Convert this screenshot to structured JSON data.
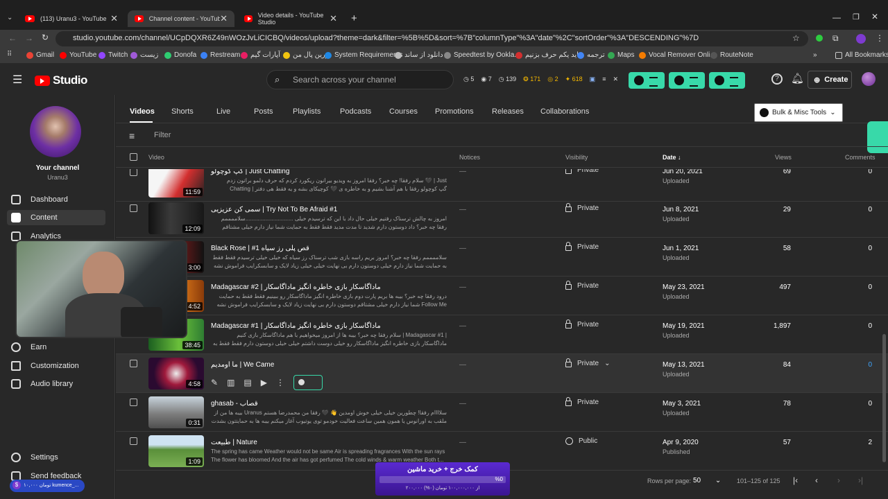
{
  "browser": {
    "tabs": [
      {
        "title": "(113) Uranu3 - YouTube",
        "active": false
      },
      {
        "title": "Channel content - YouTube Stu",
        "active": true
      },
      {
        "title": "Video details - YouTube Studio",
        "active": false
      }
    ],
    "url": "studio.youtube.com/channel/UCpDQXR6Z49nWOzJvLiCICBQ/videos/upload?theme=dark&filter=%5B%5D&sort=%7B\"columnType\"%3A\"date\"%2C\"sortOrder\"%3A\"DESCENDING\"%7D",
    "bookmarks": [
      "Gmail",
      "YouTube",
      "Twitch",
      "زیست",
      "Donofa",
      "Restream",
      "آپارات گیم",
      "زرین پال من",
      "System Requirements",
      "دانلود از ساند",
      "Speedtest by Ookla...",
      "بیاید یکم حرف بزنیم",
      "ترجمه",
      "Maps",
      "Vocal Remover Onli...",
      "RouteNote"
    ],
    "all_bookmarks": "All Bookmarks"
  },
  "studio": {
    "logo": "Studio",
    "search_placeholder": "Search across your channel",
    "stats": [
      "5",
      "7",
      "139",
      "171",
      "2",
      "618"
    ],
    "create": "Create"
  },
  "sidebar": {
    "your_channel": "Your channel",
    "channel_name": "Uranu3",
    "items": [
      {
        "label": "Dashboard",
        "icon": "dashboard-icon",
        "active": false
      },
      {
        "label": "Content",
        "icon": "content-icon",
        "active": true
      },
      {
        "label": "Analytics",
        "icon": "analytics-icon",
        "active": false
      },
      {
        "label": "Earn",
        "icon": "dollar-icon",
        "active": false
      },
      {
        "label": "Customization",
        "icon": "customization-icon",
        "active": false
      },
      {
        "label": "Audio library",
        "icon": "audio-library-icon",
        "active": false
      }
    ],
    "settings": "Settings",
    "send_feedback": "Send feedback"
  },
  "content_tabs": [
    "Videos",
    "Shorts",
    "Live",
    "Posts",
    "Playlists",
    "Podcasts",
    "Courses",
    "Promotions",
    "Releases",
    "Collaborations"
  ],
  "bulk_tools": "Bulk & Misc Tools",
  "filter_placeholder": "Filter",
  "columns": {
    "video": "Video",
    "notices": "Notices",
    "visibility": "Visibility",
    "date": "Date",
    "views": "Views",
    "comments": "Comments"
  },
  "videos": [
    {
      "title": "گپ کوچولو | Just Chatting",
      "desc": "سلام رفقا! چه خبر؟ رفقا امروز به ویدیو بیرانون ریکورد کردم که حرف دلمو براتون زدم 🖤 | Just Chatting | گپ کوچولو\nرفقا با هم آشنا بشیم و به خاطره ی 🖤 کوچیکای بشه و یه فقط هی دفتر خاطرهامون 💗 دوستون دارم بی نهایت فقط فقط به حمایت",
      "duration": "11:59",
      "notice": "—",
      "visibility": "Private",
      "date": "Jun 20, 2021",
      "date_sub": "Uploaded",
      "views": "69",
      "comments": "0"
    },
    {
      "title": "سمی کن عزیزیی | Try Not To Be Afraid #1",
      "desc": "امروز به چالش ترسناک رفتیم خیلی حال داد با این که ترسیدم خیلی ...............................سلاممممم رفقا چه خبر؟\nداد دوستون دارم شدید تا مدت مدید فقط فقط به حمایت شما نیاز دارم خیلی مشتاقم دوستون دارم خیلی ... Follow Me",
      "duration": "12:09",
      "notice": "—",
      "visibility": "Private",
      "date": "Jun 8, 2021",
      "date_sub": "Uploaded",
      "views": "29",
      "comments": "0"
    },
    {
      "title": "Black Rose | #1 قص پلی رز سیاه",
      "desc": "سلاممممم رفقا چه خبر؟ امروز بریم راسه بازی شب ترسناک رز سیاه که خیلی خیلی ترسیدم فقط فقط به حمایت شما نیاز دارم خیلی\nدوستون دارم بی نهایت خیلی خیلی زیاد لایک و سابسکرایب فراموش نشه Follow Me On Social Medias ⬇ Instagram:...",
      "duration": "3:00",
      "notice": "—",
      "visibility": "Private",
      "date": "Jun 1, 2021",
      "date_sub": "Uploaded",
      "views": "58",
      "comments": "0"
    },
    {
      "title": "Madagascar #2 | ماداگاسکار بازی خاطره انگیز ماداگاسکار",
      "desc": "درود رفقا چه خبر؟ بیبه ها بریم پارت دوم بازی خاطره انگیز ماداگاسکار رو ببینیم فقط فقط به حمایت شما نیاز دارم خیلی مشتاقم\nدوستون دارم بی نهایت زیاد لایک و سابسکرایب فراموش نشه Follow Me On Social Medias ⬇ Instagram:...",
      "duration": "4:52",
      "notice": "—",
      "visibility": "Private",
      "date": "May 23, 2021",
      "date_sub": "Uploaded",
      "views": "497",
      "comments": "0"
    },
    {
      "title": "Madagascar #1 | ماداگاسکار بازی خاطره انگیز ماداگاسکار",
      "desc": "سلام رفقا چه خبر؟ بیبه ها از امروز میخواهیم با هم ماداگاسکار بازی کنیم | Madagascar #1 | ماداگاسکار بازی خاطره انگیز\nماداگاسکار رو خیلی دوست داشتم خیلی خیلی دوستون دارم فقط فقط به حمایت شما نیاز دارم خیلی مشتاقم ... Follow",
      "duration": "38:45",
      "notice": "—",
      "visibility": "Private",
      "date": "May 19, 2021",
      "date_sub": "Uploaded",
      "views": "1,897",
      "comments": "0"
    },
    {
      "title": "ما اومدیم | We Came",
      "desc": "",
      "duration": "4:58",
      "notice": "—",
      "visibility": "Private",
      "date": "May 13, 2021",
      "date_sub": "Uploaded",
      "views": "84",
      "comments": "0"
    },
    {
      "title": "ghasab - قصاب",
      "desc": "بیبه ها من از Uranus سلاااام رفقا! چطورین خیلی خیلی خوش اومدین 👋 🖤 رفقا من محمدرضا هستم ملقب به اورانوس یا همون\nهمین ساعت فعالیت خودمو توی یوتیوب آغاز میکنم بیبه ها به حمایتتون بشدت نیاز دارم خیلی خیلی خوبید مشتاقم ممنون 🙂 😊",
      "duration": "0:31",
      "notice": "—",
      "visibility": "Private",
      "date": "May 3, 2021",
      "date_sub": "Uploaded",
      "views": "78",
      "comments": "0"
    },
    {
      "title": "طبیعت | Nature",
      "desc": "The spring has came Weather would not be same Air is spreading fragrances With the sun rays\nThe flower has bloomed And the air has got perfumed The cold winds & warm weather Both t...",
      "duration": "1:09",
      "notice": "—",
      "visibility": "Public",
      "date": "Apr 9, 2020",
      "date_sub": "Published",
      "views": "57",
      "comments": "2"
    }
  ],
  "pagination": {
    "rows_label": "Rows per page:",
    "rows_value": "50",
    "range": "101–125 of 125"
  },
  "banner": {
    "title": "کمک خرج + خرید ماشین",
    "percent": "%0",
    "amount": "۲۰۰,۰۰۰ از ۱۰۰,۰۰۰,۰۰۰ تومان (۰%)"
  },
  "bottom_pill": "۱۰,۰۰۰ تومان kumence_..."
}
